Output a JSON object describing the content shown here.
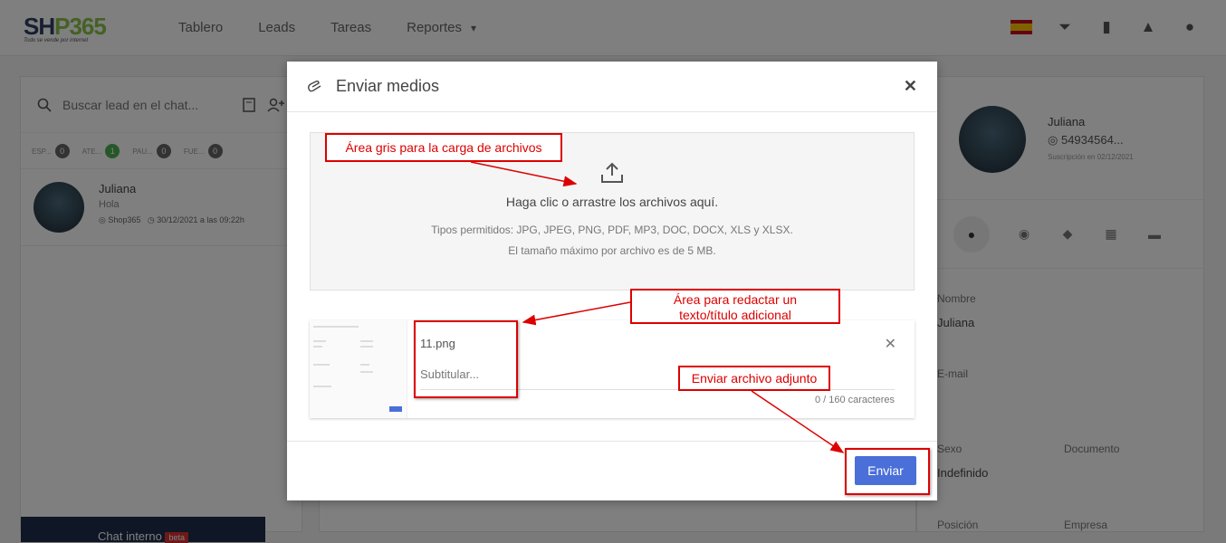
{
  "logo": {
    "main_a": "SH",
    "main_b": "P",
    "main_c": "365",
    "tagline": "Todo se vende por internet"
  },
  "nav": [
    "Tablero",
    "Leads",
    "Tareas",
    "Reportes"
  ],
  "left": {
    "search_placeholder": "Buscar lead en el chat...",
    "tabs": [
      {
        "label": "ESP...",
        "count": "0"
      },
      {
        "label": "ATE...",
        "count": "1"
      },
      {
        "label": "PAU...",
        "count": "0"
      },
      {
        "label": "FUE...",
        "count": "0"
      }
    ],
    "chat": {
      "name": "Juliana",
      "message": "Hola",
      "source": "Shop365",
      "time": "30/12/2021 a las 09:22h"
    },
    "internal_chat": "Chat interno",
    "beta": "beta"
  },
  "right": {
    "name": "Juliana",
    "phone": "54934564...",
    "subscribed": "Suscripción en 02/12/2021",
    "fields": {
      "nombre_label": "Nombre",
      "nombre_value": "Juliana",
      "email_label": "E-mail",
      "sexo_label": "Sexo",
      "sexo_value": "Indefinido",
      "documento_label": "Documento",
      "posicion_label": "Posición",
      "empresa_label": "Empresa"
    }
  },
  "modal": {
    "title": "Enviar medios",
    "drop_main": "Haga clic o arrastre los archivos aquí.",
    "drop_types": "Tipos permitidos: JPG, JPEG, PNG, PDF, MP3, DOC, DOCX, XLS y XLSX.",
    "drop_size": "El tamaño máximo por archivo es de 5 MB.",
    "file_name": "11.png",
    "caption_placeholder": "Subtitular...",
    "counter": "0 / 160 caracteres",
    "send": "Enviar"
  },
  "annotations": {
    "upload_area": "Área gris para la carga de archivos",
    "caption_area_1": "Área para redactar un",
    "caption_area_2": "texto/título adicional",
    "send_file": "Enviar archivo adjunto"
  },
  "colors": {
    "accent": "#4a6fd8",
    "annotation": "#dd0000",
    "brand_green": "#8bc34a",
    "brand_navy": "#2e3f63"
  }
}
